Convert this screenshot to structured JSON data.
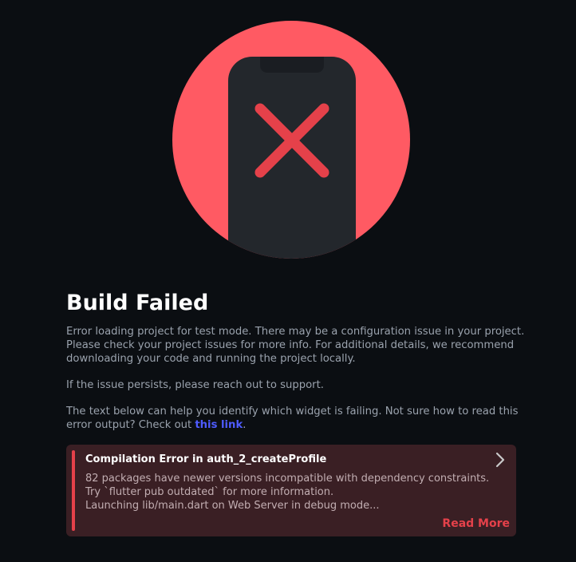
{
  "status": {
    "illustration_icon": "phone-error-icon",
    "title": "Build Failed",
    "description": "Error loading project for test mode. There may be a configuration issue in your project. Please check your project issues for more info. For additional details, we recommend downloading your code and running the project locally.",
    "support_text": "If the issue persists, please reach out to support.",
    "help_text_before_link": "The text below can help you identify which widget is failing. Not sure how to read this error output? Check out ",
    "help_link_label": "this link",
    "help_text_after_link": "."
  },
  "error_card": {
    "title": "Compilation Error in auth_2_createProfile",
    "log_lines": [
      "82 packages have newer versions incompatible with dependency constraints.",
      "Try `flutter pub outdated` for more information.",
      "Launching lib/main.dart on Web Server in debug mode..."
    ],
    "read_more_label": "Read More",
    "expand_icon": "chevron-right-icon"
  },
  "colors": {
    "background": "#0b0e12",
    "circle": "#ff5a63",
    "phone": "#23272c",
    "error_x": "#e5414a",
    "card_background": "#3a1f24",
    "accent": "#e5414a",
    "link": "#4e5bff"
  }
}
